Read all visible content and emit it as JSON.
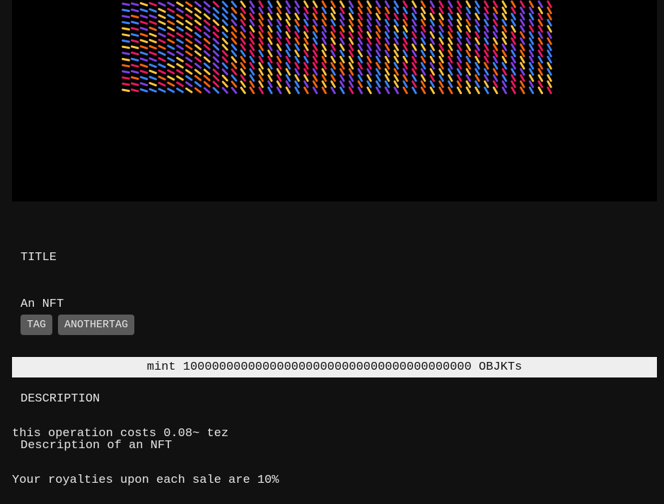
{
  "artwork": {
    "stroke_colors": [
      "#ffc53d",
      "#e8175d",
      "#7b3fe4",
      "#3b82f6",
      "#f4630c"
    ],
    "background": "#000000"
  },
  "meta": {
    "title_label": "TITLE",
    "title_value": "An NFT",
    "description_label": "DESCRIPTION",
    "description_value": "Description of an NFT"
  },
  "tags": [
    "TAG",
    "ANOTHERTAG"
  ],
  "mint": {
    "label": "mint 1000000000000000000000000000000000000000 OBJKTs"
  },
  "info": {
    "cost": "this operation costs 0.08~ tez",
    "royalties": "Your royalties upon each sale are 10%"
  }
}
